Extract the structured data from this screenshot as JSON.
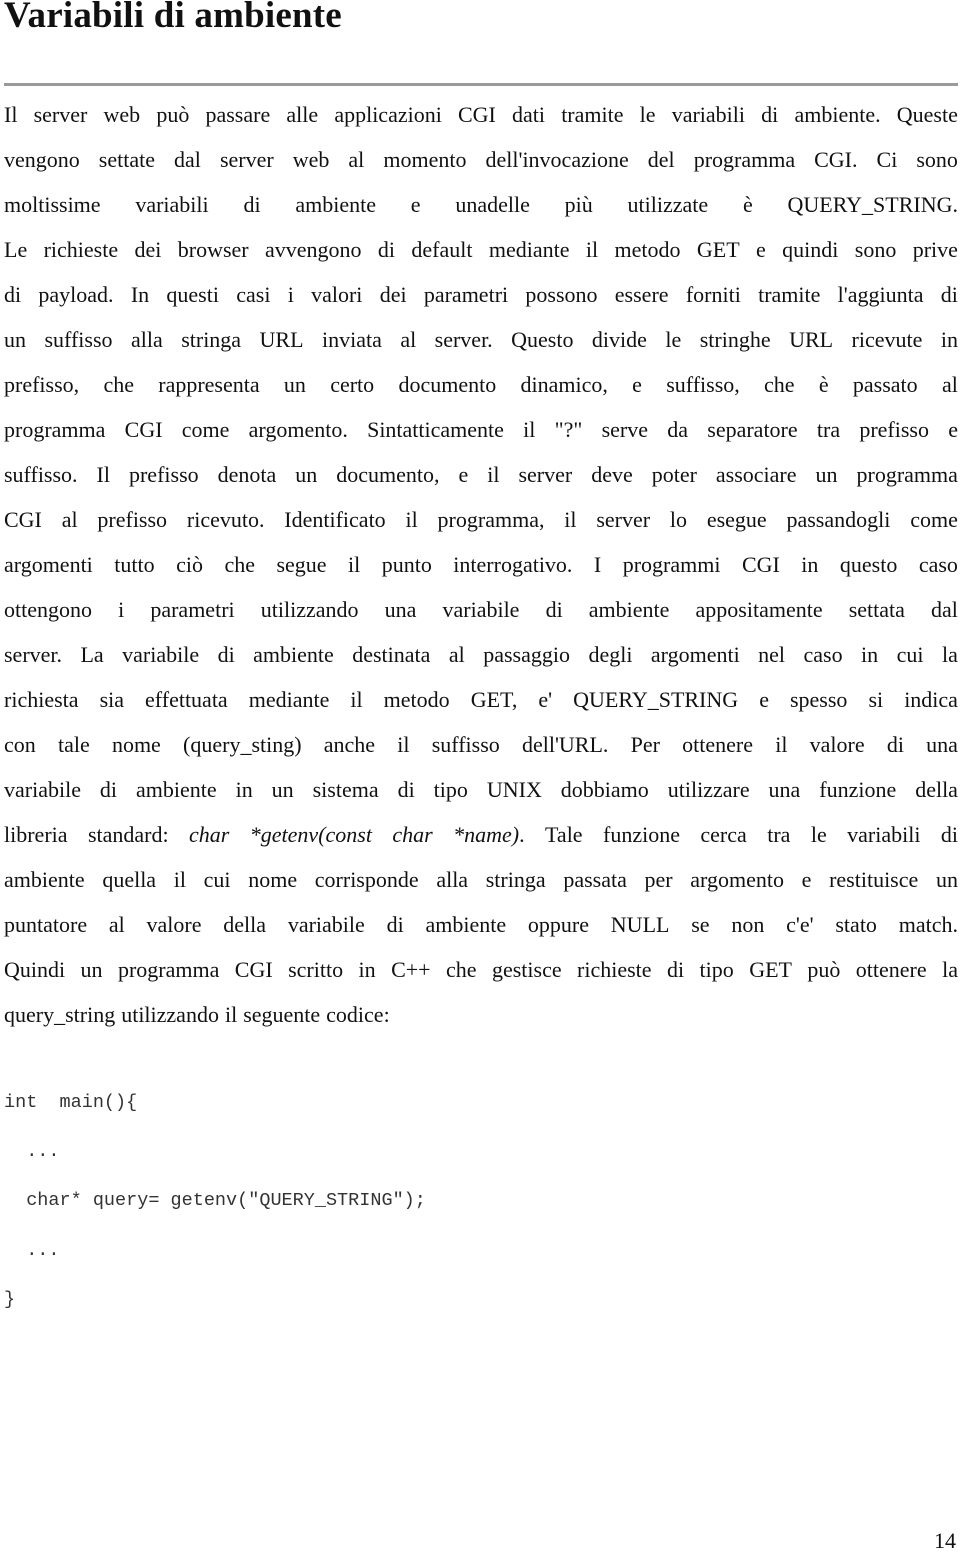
{
  "page": {
    "title": "Variabili di ambiente",
    "page_number": "14"
  },
  "paragraph": {
    "lines": [
      "Il server web può passare alle applicazioni CGI dati tramite le variabili di ambiente. Queste",
      "vengono settate dal server web al momento dell'invocazione del programma CGI. Ci sono",
      "moltissime variabili di ambiente e unadelle più utilizzate è QUERY_STRING.",
      "Le richieste dei browser avvengono di default mediante il metodo GET e quindi sono prive",
      "di payload. In questi casi i valori dei parametri possono essere forniti tramite l'aggiunta di",
      "un suffisso alla stringa URL inviata al server. Questo divide le stringhe URL ricevute in",
      "prefisso, che rappresenta un certo documento dinamico, e suffisso, che è passato al",
      "programma CGI come argomento. Sintatticamente il \"?\" serve da separatore tra prefisso e",
      "suffisso. Il prefisso denota un documento, e il server deve poter associare un programma",
      "CGI al prefisso ricevuto. Identificato il programma, il server lo esegue passandogli come",
      "argomenti tutto ciò che segue il punto interrogativo. I programmi CGI in questo caso",
      "ottengono i parametri utilizzando una variabile di ambiente appositamente settata dal",
      "server. La variabile di ambiente destinata al passaggio degli argomenti nel caso in cui la",
      "richiesta sia effettuata mediante il metodo GET, e' QUERY_STRING e spesso si indica",
      "con tale nome (query_sting) anche il suffisso dell'URL. Per ottenere il valore di una",
      "variabile di ambiente in un sistema di tipo UNIX dobbiamo utilizzare una funzione della",
      {
        "before": "libreria standard: ",
        "italic": "char *getenv(const char *name)",
        "after": ". Tale funzione cerca tra le variabili di"
      },
      "ambiente quella il cui nome corrisponde alla stringa passata per argomento e restituisce un",
      "puntatore al valore della variabile di ambiente oppure NULL se non c'e' stato match.",
      "Quindi un programma CGI scritto in C++ che gestisce richieste di tipo GET può ottenere la",
      "query_string utilizzando il seguente codice:"
    ]
  },
  "code": {
    "lines": [
      "int  main(){",
      "  ...",
      "  char* query= getenv(\"QUERY_STRING\");",
      "  ...",
      "}"
    ]
  }
}
